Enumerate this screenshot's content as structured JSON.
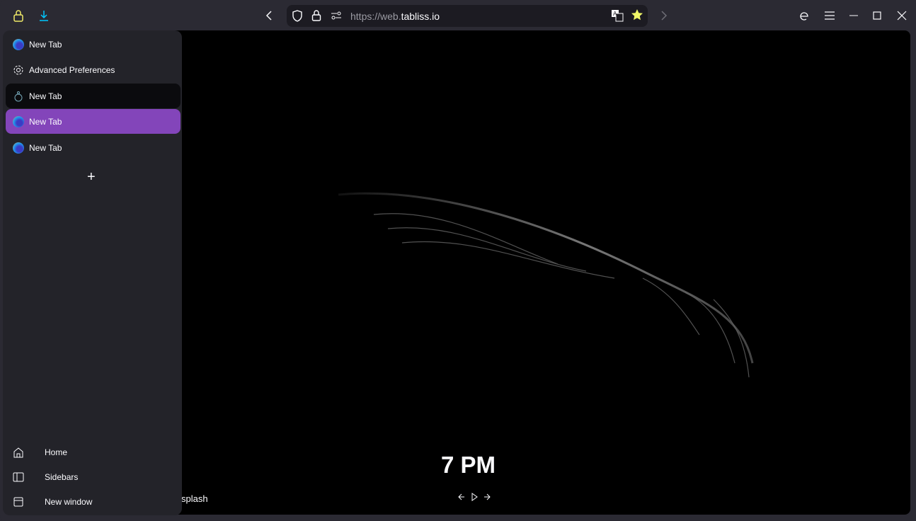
{
  "toolbar": {
    "url_scheme": "https://web.",
    "url_host": "tabliss.io"
  },
  "sidebar": {
    "tabs": [
      {
        "label": "New Tab",
        "icon": "firefox-icon",
        "state": "normal"
      },
      {
        "label": "Advanced Preferences",
        "icon": "gear-icon",
        "state": "normal"
      },
      {
        "label": "New Tab",
        "icon": "tabliss-icon",
        "state": "hover"
      },
      {
        "label": "New Tab",
        "icon": "firefox-icon",
        "state": "selected"
      },
      {
        "label": "New Tab",
        "icon": "firefox-icon",
        "state": "normal"
      }
    ],
    "new_tab_label": "+",
    "bottom": [
      {
        "label": "Home",
        "icon": "home-icon"
      },
      {
        "label": "Sidebars",
        "icon": "sidebar-icon"
      },
      {
        "label": "New window",
        "icon": "window-icon"
      }
    ]
  },
  "page": {
    "time": "7 PM",
    "credit": "splash"
  },
  "colors": {
    "accent": "#8345ba",
    "lock": "#f0e968",
    "download": "#00c8ff",
    "star": "#f0f768"
  }
}
